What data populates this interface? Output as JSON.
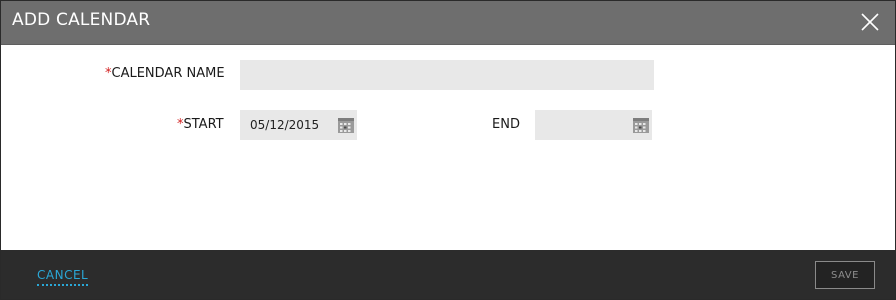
{
  "dialog": {
    "title": "ADD CALENDAR",
    "close_icon": "close-icon"
  },
  "form": {
    "calendar_name": {
      "required_mark": "*",
      "label": "CALENDAR NAME",
      "value": "",
      "placeholder": ""
    },
    "start": {
      "required_mark": "*",
      "label": "START",
      "value": "05/12/2015",
      "icon": "calendar-icon"
    },
    "end": {
      "label": "END",
      "value": "",
      "icon": "calendar-icon"
    }
  },
  "footer": {
    "cancel_label": "CANCEL",
    "save_label": "SAVE"
  },
  "colors": {
    "header_bg": "#6e6e6e",
    "footer_bg": "#2c2c2c",
    "field_bg": "#e8e8e8",
    "required": "#d21f1f",
    "link": "#2aa7d6"
  }
}
